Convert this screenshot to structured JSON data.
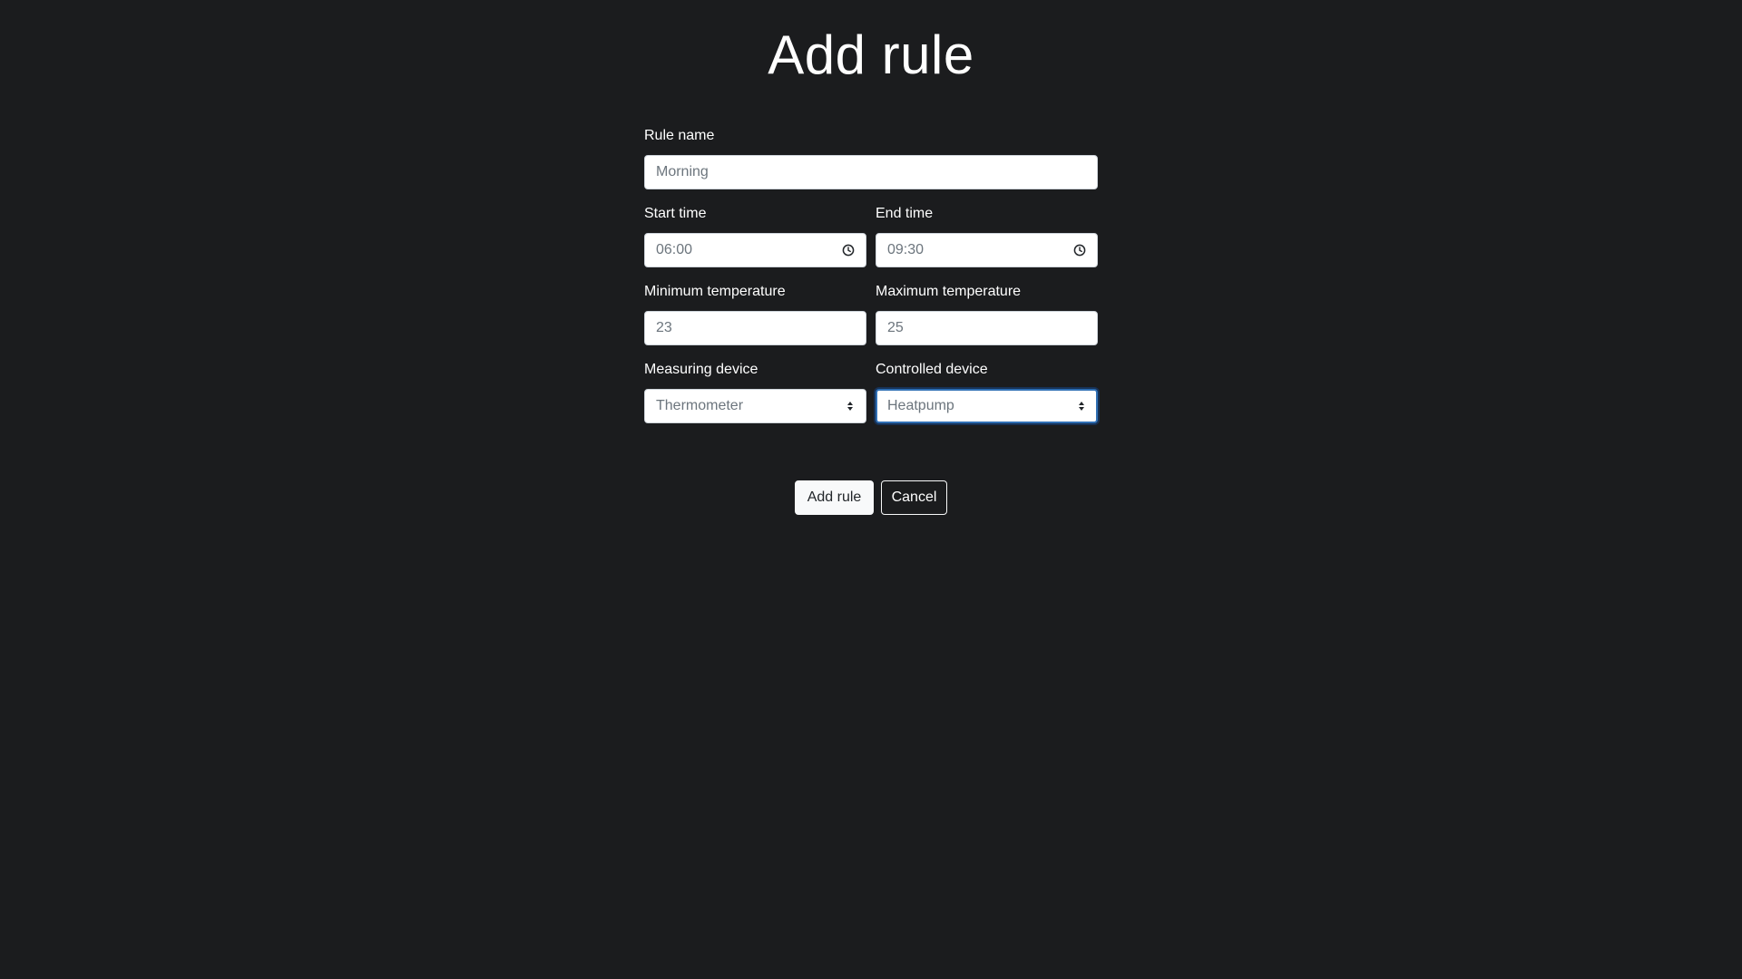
{
  "page": {
    "title": "Add rule"
  },
  "form": {
    "rule_name": {
      "label": "Rule name",
      "value": "Morning"
    },
    "start_time": {
      "label": "Start time",
      "value": "06:00",
      "icon": "clock-icon"
    },
    "end_time": {
      "label": "End time",
      "value": "09:30",
      "icon": "clock-icon"
    },
    "min_temperature": {
      "label": "Minimum temperature",
      "value": "23"
    },
    "max_temperature": {
      "label": "Maximum temperature",
      "value": "25"
    },
    "measuring_device": {
      "label": "Measuring device",
      "selected": "Thermometer",
      "icon": "select-arrows-icon"
    },
    "controlled_device": {
      "label": "Controlled device",
      "selected": "Heatpump",
      "icon": "select-arrows-icon",
      "focused": true
    }
  },
  "actions": {
    "submit_label": "Add rule",
    "cancel_label": "Cancel"
  },
  "colors": {
    "background": "#1b1c1e",
    "text": "#ffffff",
    "input_background": "#ffffff",
    "input_text": "#6c757d",
    "focus_border": "#2f6fb4"
  }
}
